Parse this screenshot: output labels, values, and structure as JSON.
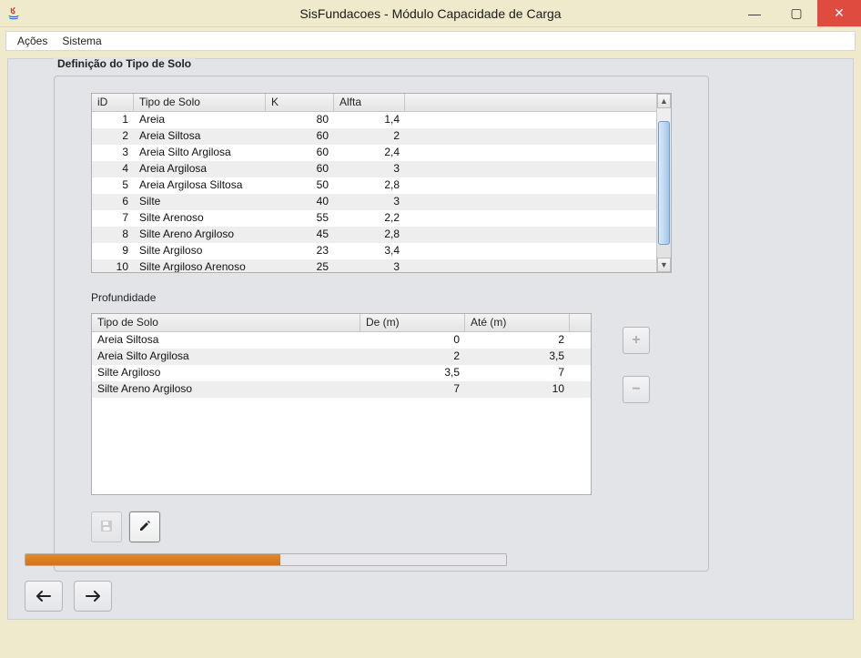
{
  "window": {
    "title": "SisFundacoes - Módulo Capacidade de Carga"
  },
  "menu": {
    "item1": "Ações",
    "item2": "Sistema"
  },
  "group": {
    "title": "Definição do Tipo de Solo"
  },
  "table1": {
    "headers": {
      "id": "iD",
      "tipo": "Tipo de Solo",
      "k": "K",
      "alfa": "Alfta"
    },
    "rows": [
      {
        "id": "1",
        "tipo": "Areia",
        "k": "80",
        "alfa": "1,4"
      },
      {
        "id": "2",
        "tipo": "Areia Siltosa",
        "k": "60",
        "alfa": "2"
      },
      {
        "id": "3",
        "tipo": "Areia Silto Argilosa",
        "k": "60",
        "alfa": "2,4"
      },
      {
        "id": "4",
        "tipo": "Areia Argilosa",
        "k": "60",
        "alfa": "3"
      },
      {
        "id": "5",
        "tipo": "Areia Argilosa Siltosa",
        "k": "50",
        "alfa": "2,8"
      },
      {
        "id": "6",
        "tipo": "Silte",
        "k": "40",
        "alfa": "3"
      },
      {
        "id": "7",
        "tipo": "Silte Arenoso",
        "k": "55",
        "alfa": "2,2"
      },
      {
        "id": "8",
        "tipo": "Silte Areno Argiloso",
        "k": "45",
        "alfa": "2,8"
      },
      {
        "id": "9",
        "tipo": "Silte Argiloso",
        "k": "23",
        "alfa": "3,4"
      },
      {
        "id": "10",
        "tipo": "Silte Argiloso Arenoso",
        "k": "25",
        "alfa": "3"
      }
    ]
  },
  "profundidade": {
    "label": "Profundidade"
  },
  "table2": {
    "headers": {
      "tipo": "Tipo de Solo",
      "de": "De (m)",
      "ate": "Até (m)"
    },
    "rows": [
      {
        "tipo": "Areia Siltosa",
        "de": "0",
        "ate": "2"
      },
      {
        "tipo": "Areia Silto Argilosa",
        "de": "2",
        "ate": "3,5"
      },
      {
        "tipo": "Silte Argiloso",
        "de": "3,5",
        "ate": "7"
      },
      {
        "tipo": "Silte Areno Argiloso",
        "de": "7",
        "ate": "10"
      }
    ]
  },
  "icons": {
    "plus": "+",
    "minus": "−",
    "save": "💾",
    "edit": "✎",
    "prev": "🡐",
    "next": "🡒",
    "min": "—",
    "max": "▢",
    "close": "✕"
  },
  "progress": {
    "percent": 53
  }
}
